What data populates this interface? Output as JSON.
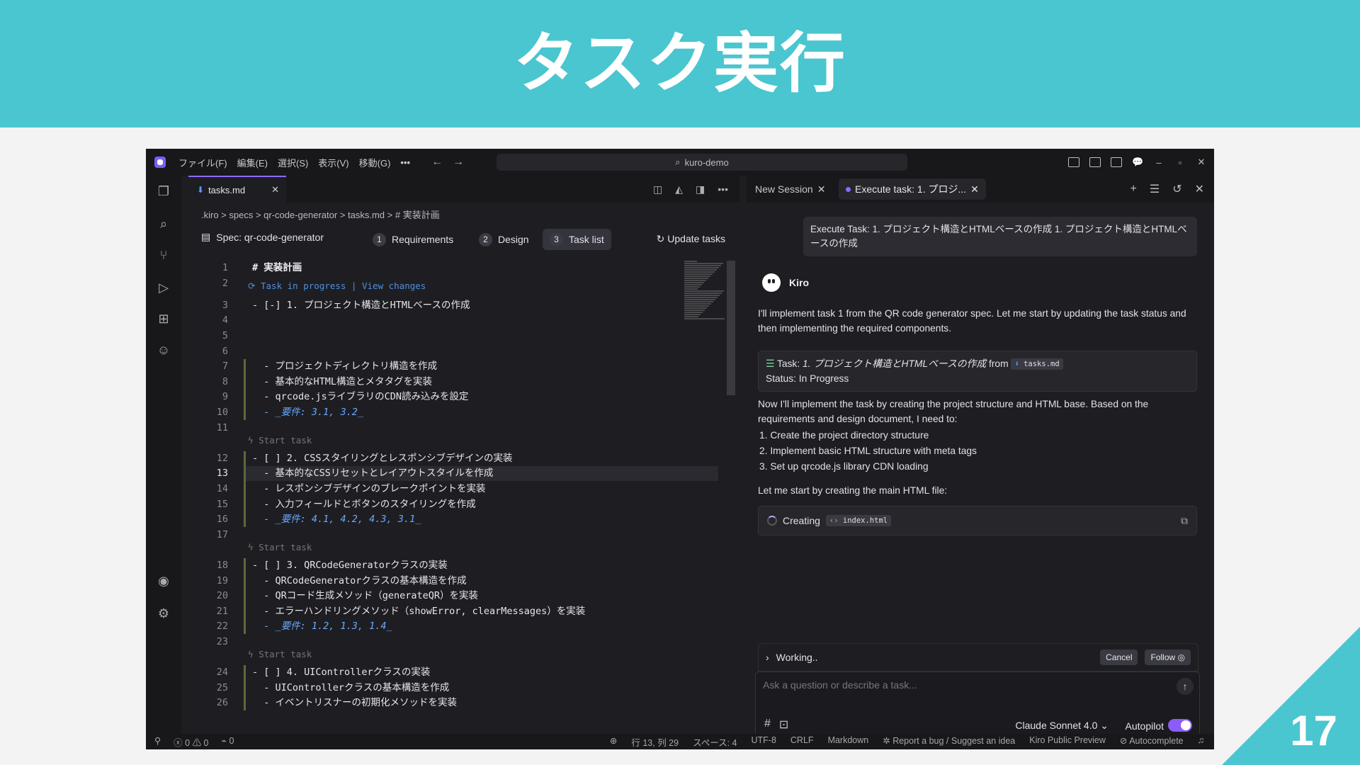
{
  "slide": {
    "title": "タスク実行",
    "page_number": "17"
  },
  "titlebar": {
    "menus": [
      "ファイル(F)",
      "編集(E)",
      "選択(S)",
      "表示(V)",
      "移動(G)"
    ],
    "more": "•••",
    "search": "kuro-demo"
  },
  "editor": {
    "tab_label": "tasks.md",
    "breadcrumb": ".kiro > specs > qr-code-generator > tasks.md > # 実装計画",
    "spec_title": "Spec: qr-code-generator",
    "steps": [
      {
        "num": "1",
        "label": "Requirements"
      },
      {
        "num": "2",
        "label": "Design"
      },
      {
        "num": "3",
        "label": "Task list"
      }
    ],
    "update_label": "Update tasks",
    "codelens_progress": "Task in progress | View changes",
    "codelens_start": "Start task",
    "lines": [
      {
        "n": "1",
        "t": "# 実装計画"
      },
      {
        "n": "2",
        "t": ""
      },
      {
        "n": "3",
        "t": "- [-] 1. プロジェクト構造とHTMLベースの作成"
      },
      {
        "n": "4",
        "t": ""
      },
      {
        "n": "5",
        "t": ""
      },
      {
        "n": "6",
        "t": ""
      },
      {
        "n": "7",
        "t": "  - プロジェクトディレクトリ構造を作成"
      },
      {
        "n": "8",
        "t": "  - 基本的なHTML構造とメタタグを実装"
      },
      {
        "n": "9",
        "t": "  - qrcode.jsライブラリのCDN読み込みを設定"
      },
      {
        "n": "10",
        "t": "  - _要件: 3.1, 3.2_"
      },
      {
        "n": "11",
        "t": ""
      },
      {
        "n": "12",
        "t": "- [ ] 2. CSSスタイリングとレスポンシブデザインの実装"
      },
      {
        "n": "13",
        "t": "  - 基本的なCSSリセットとレイアウトスタイルを作成"
      },
      {
        "n": "14",
        "t": "  - レスポンシブデザインのブレークポイントを実装"
      },
      {
        "n": "15",
        "t": "  - 入力フィールドとボタンのスタイリングを作成"
      },
      {
        "n": "16",
        "t": "  - _要件: 4.1, 4.2, 4.3, 3.1_"
      },
      {
        "n": "17",
        "t": ""
      },
      {
        "n": "18",
        "t": "- [ ] 3. QRCodeGeneratorクラスの実装"
      },
      {
        "n": "19",
        "t": "  - QRCodeGeneratorクラスの基本構造を作成"
      },
      {
        "n": "20",
        "t": "  - QRコード生成メソッド（generateQR）を実装"
      },
      {
        "n": "21",
        "t": "  - エラーハンドリングメソッド（showError, clearMessages）を実装"
      },
      {
        "n": "22",
        "t": "  - _要件: 1.2, 1.3, 1.4_"
      },
      {
        "n": "23",
        "t": ""
      },
      {
        "n": "24",
        "t": "- [ ] 4. UIControllerクラスの実装"
      },
      {
        "n": "25",
        "t": "  - UIControllerクラスの基本構造を作成"
      },
      {
        "n": "26",
        "t": "  - イベントリスナーの初期化メソッドを実装"
      }
    ]
  },
  "chat": {
    "tab_new": "New Session",
    "tab_exec": "Execute task: 1. プロジ...",
    "user_message": "Execute Task: 1. プロジェクト構造とHTMLベースの作成 1. プロジェクト構造とHTMLベースの作成",
    "agent_name": "Kiro",
    "para1": "I'll implement task 1 from the QR code generator spec. Let me start by updating the task status and then implementing the required components.",
    "task_card_prefix": "Task: ",
    "task_card_title": "1. プロジェクト構造とHTMLベースの作成",
    "task_card_from": " from ",
    "task_card_file": "tasks.md",
    "task_card_status": "Status: In Progress",
    "para2": "Now I'll implement the task by creating the project structure and HTML base. Based on the requirements and design document, I need to:",
    "list": [
      "1. Create the project directory structure",
      "2. Implement basic HTML structure with meta tags",
      "3. Set up qrcode.js library CDN loading"
    ],
    "para3": "Let me start by creating the main HTML file:",
    "creating_label": "Creating",
    "creating_file": "index.html",
    "working_label": "Working..",
    "cancel_label": "Cancel",
    "follow_label": "Follow",
    "input_placeholder": "Ask a question or describe a task...",
    "model_label": "Claude Sonnet 4.0",
    "autopilot_label": "Autopilot",
    "autopilot_on": true
  },
  "statusbar": {
    "errors": "0",
    "warnings": "0",
    "ports": "0",
    "position": "行 13, 列 29",
    "spaces": "スペース: 4",
    "encoding": "UTF-8",
    "eol": "CRLF",
    "language": "Markdown",
    "report": "Report a bug / Suggest an idea",
    "preview": "Kiro Public Preview",
    "autocomplete": "Autocomplete"
  },
  "colors": {
    "accent": "#8b5cf6",
    "slide": "#49c6cf"
  }
}
